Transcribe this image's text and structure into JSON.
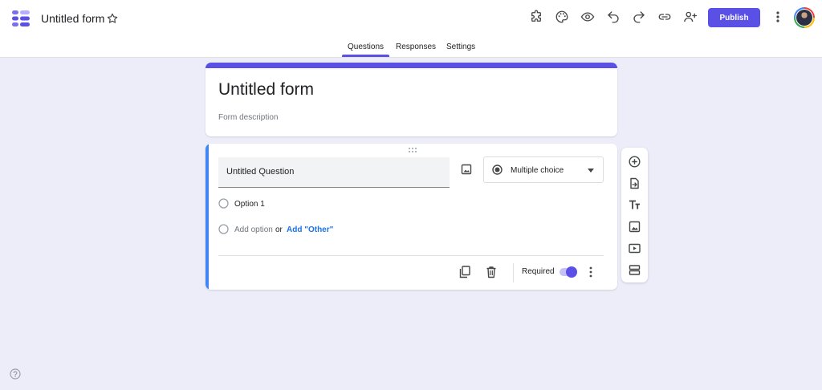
{
  "header": {
    "doc_title": "Untitled form",
    "publish_label": "Publish",
    "icons": [
      "addons-icon",
      "palette-icon",
      "preview-eye-icon",
      "undo-icon",
      "redo-icon",
      "link-icon",
      "add-collaborator-icon",
      "more-vert-icon"
    ]
  },
  "tabs": [
    {
      "label": "Questions",
      "active": true
    },
    {
      "label": "Responses",
      "active": false
    },
    {
      "label": "Settings",
      "active": false
    }
  ],
  "form": {
    "title": "Untitled form",
    "description_placeholder": "Form description"
  },
  "question": {
    "title": "Untitled Question",
    "type_label": "Multiple choice",
    "options": [
      "Option 1"
    ],
    "add_option": "Add option",
    "or": "or",
    "add_other": "Add \"Other\"",
    "required_label": "Required",
    "required": true
  },
  "side_toolbar": [
    "add-question-icon",
    "import-questions-icon",
    "add-title-icon",
    "add-image-icon",
    "add-video-icon",
    "add-section-icon"
  ],
  "colors": {
    "accent": "#5a50e6",
    "active_question": "#4285f4",
    "link": "#1a73e8",
    "background": "#ededfa"
  }
}
